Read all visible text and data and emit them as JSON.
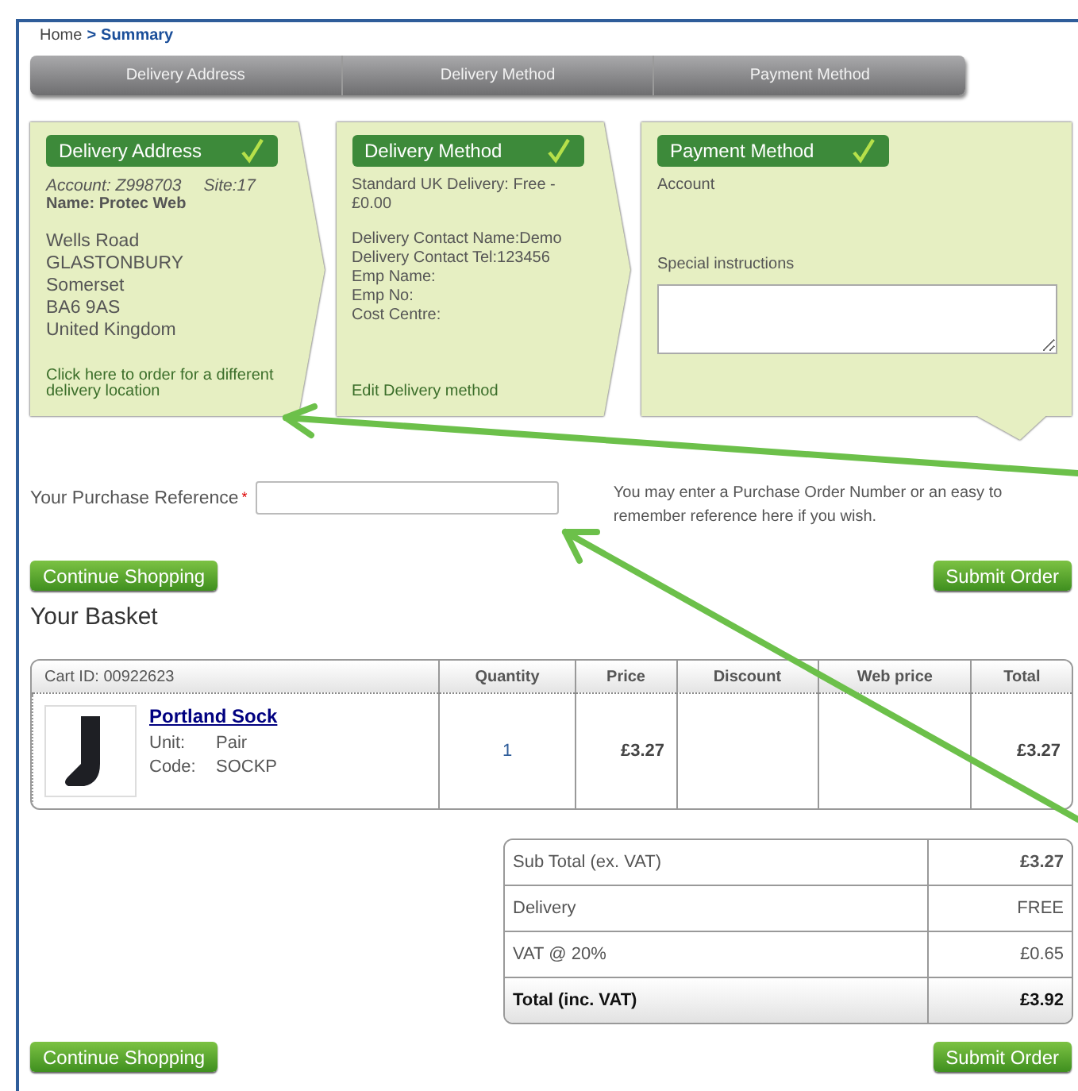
{
  "breadcrumb": {
    "home": "Home",
    "separator": ">",
    "current": "Summary"
  },
  "steps": [
    "Delivery Address",
    "Delivery Method",
    "Payment Method"
  ],
  "cards": [
    {
      "kind": "address",
      "heading": "Delivery Address",
      "completed": true,
      "account": "Account: Z998703",
      "site": "Site:17",
      "name_label": "Name:",
      "name": "Protec Web",
      "lines": [
        "Wells Road",
        "GLASTONBURY",
        "Somerset",
        "BA6 9AS",
        "United Kingdom"
      ],
      "link": "Click here to order for a different delivery location"
    },
    {
      "kind": "method",
      "heading": "Delivery Method",
      "completed": true,
      "lines": [
        "Standard UK Delivery: Free - £0.00"
      ],
      "contact_lines": [
        "Delivery Contact Name:Demo",
        "Delivery Contact Tel:123456",
        "Emp Name:",
        "Emp No:",
        "Cost Centre:"
      ],
      "link": "Edit Delivery method"
    },
    {
      "kind": "payment",
      "heading": "Payment Method",
      "completed": true,
      "lines": [
        "Account"
      ],
      "instructions_label": "Special instructions"
    }
  ],
  "purchase_reference": {
    "label": "Your Purchase Reference",
    "required_mark": "*",
    "hint": "You may enter a Purchase Order Number or an easy to remember reference here if you wish."
  },
  "top_actions": {
    "continue": "Continue Shopping",
    "submit": "Submit Order"
  },
  "basket": {
    "title": "Your Basket",
    "columns": [
      "Cart ID: 00922623",
      "Quantity",
      "Price",
      "Discount",
      "Web price",
      "Total"
    ],
    "rows": [
      {
        "product": "Portland Sock",
        "unit_label": "Unit:",
        "unit": "Pair",
        "code_label": "Code:",
        "code": "SOCKP",
        "quantity": "1",
        "price": "£3.27",
        "total": "£3.27"
      }
    ]
  },
  "totals": [
    {
      "kind": "subtotal",
      "label": "Sub Total (ex. VAT)",
      "value": "£3.27"
    },
    {
      "kind": "normal",
      "label": "Delivery",
      "value": "FREE"
    },
    {
      "kind": "normal",
      "label": "VAT @ 20%",
      "value": "£0.65"
    },
    {
      "kind": "grand",
      "label": "Total (inc. VAT)",
      "value": "£3.92"
    }
  ],
  "bottom_actions": {
    "continue": "Continue Shopping",
    "submit": "Submit Order"
  }
}
